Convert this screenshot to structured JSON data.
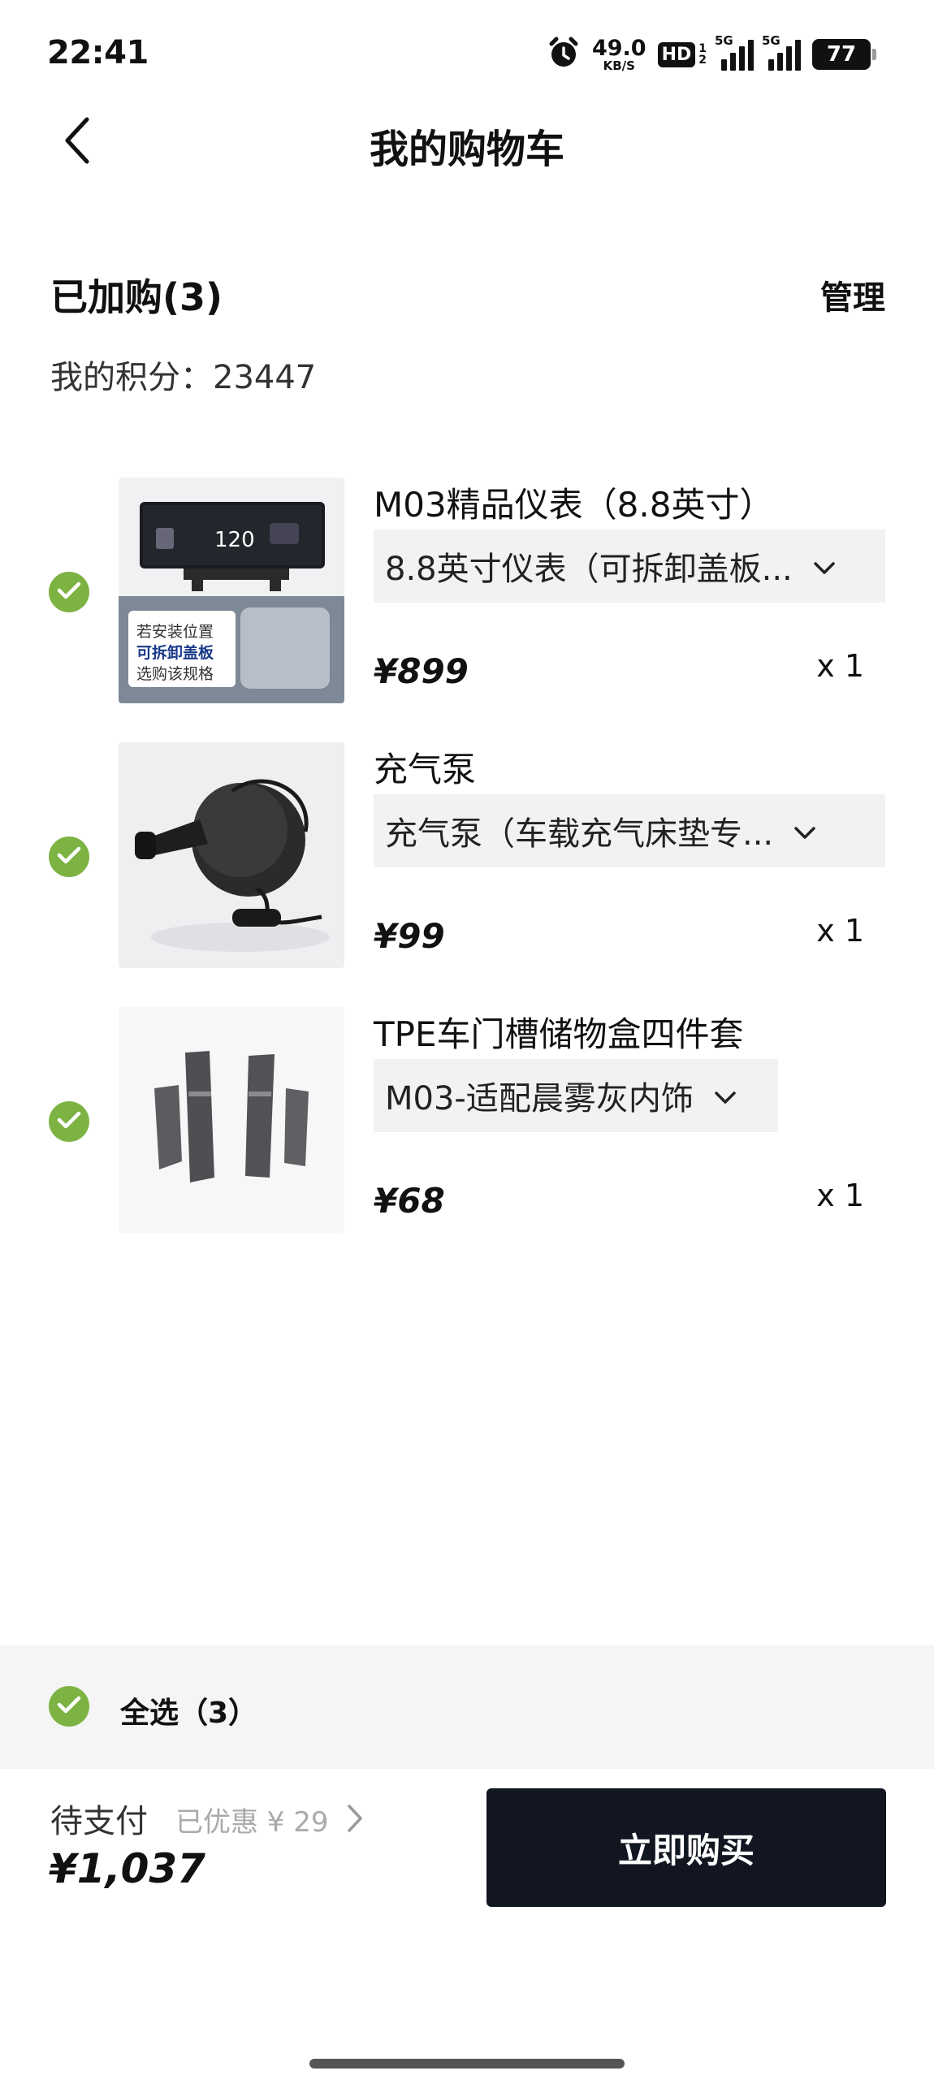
{
  "status_bar": {
    "time": "22:41",
    "net_speed": "49.0",
    "net_unit": "KB/S",
    "hd_label": "HD",
    "hd_sub_top": "1",
    "hd_sub_bottom": "2",
    "signal1_tag": "5G",
    "signal2_tag": "5G",
    "battery": "77"
  },
  "header": {
    "title": "我的购物车"
  },
  "cart": {
    "heading": "已加购(3)",
    "manage_label": "管理",
    "points_label": "我的积分：23447"
  },
  "items": [
    {
      "name": "M03精品仪表（8.8英寸）",
      "variant": "8.8英寸仪表（可拆卸盖板...",
      "price": "¥899",
      "qty": "x 1",
      "image_caption_1": "若安装位置",
      "image_caption_2": "可拆卸盖板",
      "image_caption_3": "选购该规格",
      "image_speed": "120"
    },
    {
      "name": "充气泵",
      "variant": "充气泵（车载充气床垫专...",
      "price": "¥99",
      "qty": "x 1"
    },
    {
      "name": "TPE车门槽储物盒四件套",
      "variant": "M03-适配晨雾灰内饰",
      "price": "¥68",
      "qty": "x 1"
    }
  ],
  "footer": {
    "select_all": "全选（3）",
    "pay_label": "待支付",
    "discount": "已优惠 ¥ 29",
    "total": "¥1,037",
    "buy_label": "立即购买"
  },
  "colors": {
    "check_green": "#7cb342",
    "buy_button": "#111621"
  },
  "icons": [
    "alarm-icon",
    "back-arrow-icon",
    "check-circle-icon",
    "chevron-down-icon",
    "chevron-right-icon"
  ]
}
